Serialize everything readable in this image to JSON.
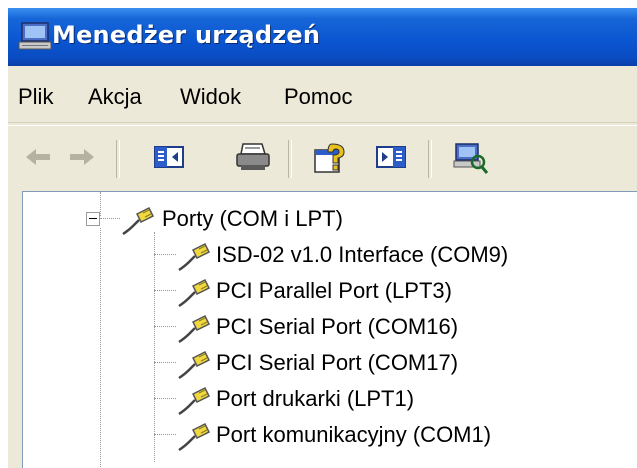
{
  "window": {
    "title": "Menedżer urządzeń"
  },
  "menu": {
    "items": [
      "Plik",
      "Akcja",
      "Widok",
      "Pomoc"
    ]
  },
  "toolbar": {
    "buttons": [
      "back-arrow-icon",
      "forward-arrow-icon",
      "show-hide-console-tree-icon",
      "print-icon",
      "help-icon",
      "show-hide-action-pane-icon",
      "scan-hardware-icon"
    ]
  },
  "tree": {
    "category": {
      "label": "Porty (COM i LPT)",
      "expanded": true,
      "icon": "port-connector-icon"
    },
    "devices": [
      {
        "label": "ISD-02 v1.0 Interface (COM9)"
      },
      {
        "label": "PCI Parallel Port (LPT3)"
      },
      {
        "label": "PCI Serial Port (COM16)"
      },
      {
        "label": "PCI Serial Port (COM17)"
      },
      {
        "label": "Port drukarki (LPT1)"
      },
      {
        "label": "Port komunikacyjny (COM1)"
      }
    ]
  }
}
